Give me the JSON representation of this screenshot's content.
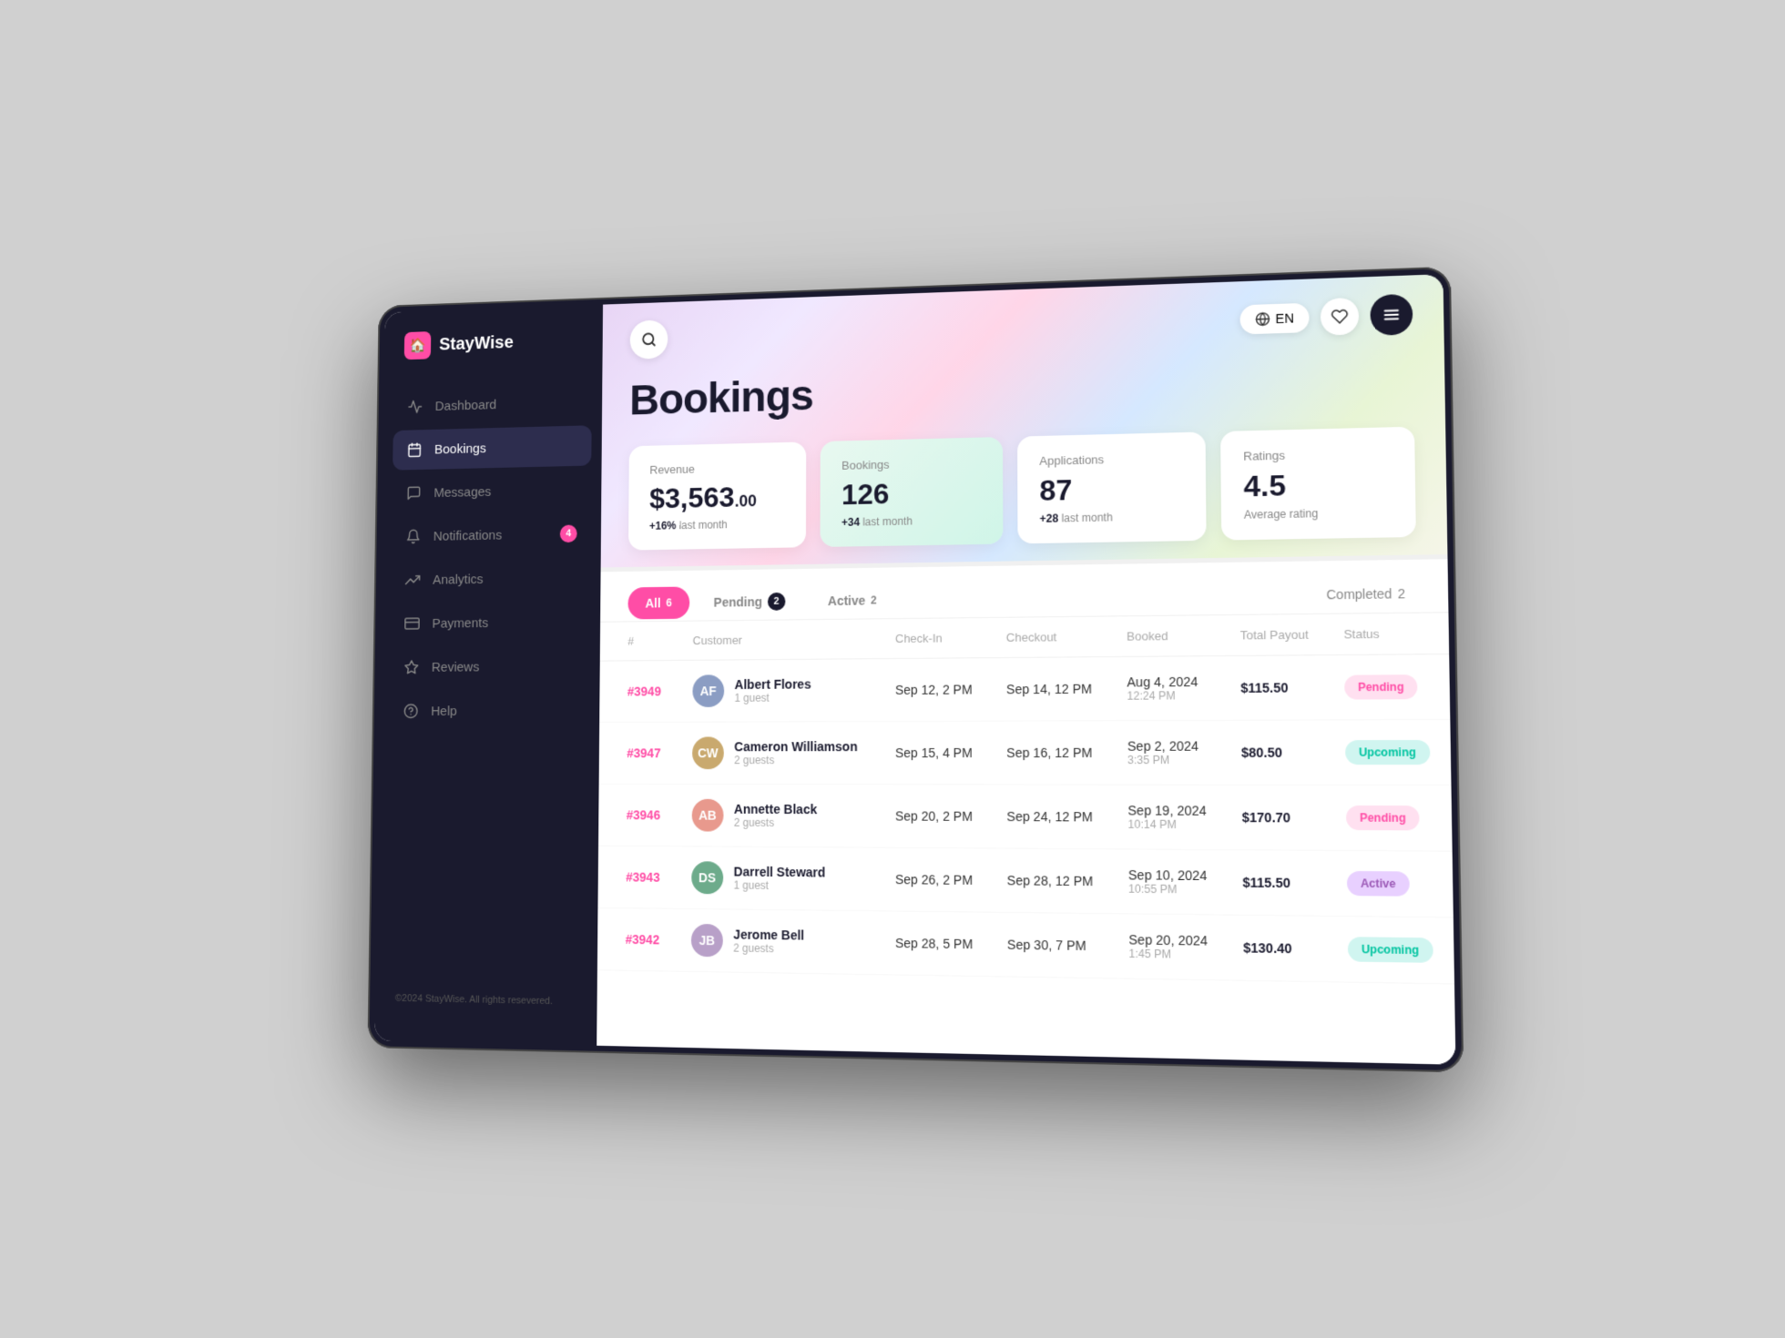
{
  "app": {
    "name": "StayWise",
    "copyright": "©2024 StayWise. All rights resevered."
  },
  "topbar": {
    "lang": "EN",
    "search_placeholder": "Search..."
  },
  "sidebar": {
    "items": [
      {
        "id": "dashboard",
        "label": "Dashboard",
        "icon": "📊",
        "active": false
      },
      {
        "id": "bookings",
        "label": "Bookings",
        "icon": "📋",
        "active": true
      },
      {
        "id": "messages",
        "label": "Messages",
        "icon": "💬",
        "active": false
      },
      {
        "id": "notifications",
        "label": "Notifications",
        "icon": "🔔",
        "active": false,
        "badge": "4"
      },
      {
        "id": "analytics",
        "label": "Analytics",
        "icon": "📈",
        "active": false
      },
      {
        "id": "payments",
        "label": "Payments",
        "icon": "💳",
        "active": false
      },
      {
        "id": "reviews",
        "label": "Reviews",
        "icon": "⭐",
        "active": false
      },
      {
        "id": "help",
        "label": "Help",
        "icon": "❓",
        "active": false
      }
    ]
  },
  "page": {
    "title": "Bookings"
  },
  "stats": [
    {
      "id": "revenue",
      "label": "Revenue",
      "value": "$3,563",
      "cents": ".00",
      "change": "+16%",
      "change_label": "last month",
      "type": "revenue"
    },
    {
      "id": "bookings",
      "label": "Bookings",
      "value": "126",
      "change": "+34",
      "change_label": "last month",
      "type": "bookings-card"
    },
    {
      "id": "applications",
      "label": "Applications",
      "value": "87",
      "change": "+28",
      "change_label": "last month",
      "type": "applications-card"
    },
    {
      "id": "ratings",
      "label": "Ratings",
      "value": "4.5",
      "subtitle": "Average rating",
      "type": "ratings-card"
    }
  ],
  "tabs": [
    {
      "id": "all",
      "label": "All",
      "count": "6",
      "active": true
    },
    {
      "id": "pending",
      "label": "Pending",
      "count": "2",
      "active": false
    },
    {
      "id": "active",
      "label": "Active",
      "count": "2",
      "active": false
    },
    {
      "id": "completed",
      "label": "Completed",
      "count": "2",
      "active": false
    }
  ],
  "table": {
    "columns": [
      "#",
      "Customer",
      "Check-In",
      "Checkout",
      "Booked",
      "Total Payout",
      "Status"
    ],
    "rows": [
      {
        "id": "#3949",
        "customer_name": "Albert Flores",
        "customer_guests": "1 guest",
        "avatar_initials": "AF",
        "avatar_class": "av-1",
        "checkin": "Sep 12, 2 PM",
        "checkout": "Sep 14, 12 PM",
        "booked_date": "Aug 4, 2024",
        "booked_time": "12:24 PM",
        "payout": "$115.50",
        "status": "Pending",
        "status_class": "status-pending"
      },
      {
        "id": "#3947",
        "customer_name": "Cameron Williamson",
        "customer_guests": "2 guests",
        "avatar_initials": "CW",
        "avatar_class": "av-2",
        "checkin": "Sep 15, 4 PM",
        "checkout": "Sep 16, 12 PM",
        "booked_date": "Sep 2, 2024",
        "booked_time": "3:35 PM",
        "payout": "$80.50",
        "status": "Upcoming",
        "status_class": "status-upcoming"
      },
      {
        "id": "#3946",
        "customer_name": "Annette Black",
        "customer_guests": "2 guests",
        "avatar_initials": "AB",
        "avatar_class": "av-3",
        "checkin": "Sep 20, 2 PM",
        "checkout": "Sep 24, 12 PM",
        "booked_date": "Sep 19, 2024",
        "booked_time": "10:14 PM",
        "payout": "$170.70",
        "status": "Pending",
        "status_class": "status-pending"
      },
      {
        "id": "#3943",
        "customer_name": "Darrell Steward",
        "customer_guests": "1 guest",
        "avatar_initials": "DS",
        "avatar_class": "av-4",
        "checkin": "Sep 26, 2 PM",
        "checkout": "Sep 28, 12 PM",
        "booked_date": "Sep 10, 2024",
        "booked_time": "10:55 PM",
        "payout": "$115.50",
        "status": "Active",
        "status_class": "status-active"
      },
      {
        "id": "#3942",
        "customer_name": "Jerome Bell",
        "customer_guests": "2 guests",
        "avatar_initials": "JB",
        "avatar_class": "av-5",
        "checkin": "Sep 28, 5 PM",
        "checkout": "Sep 30, 7 PM",
        "booked_date": "Sep 20, 2024",
        "booked_time": "1:45 PM",
        "payout": "$130.40",
        "status": "Upcoming",
        "status_class": "status-upcoming"
      }
    ]
  }
}
